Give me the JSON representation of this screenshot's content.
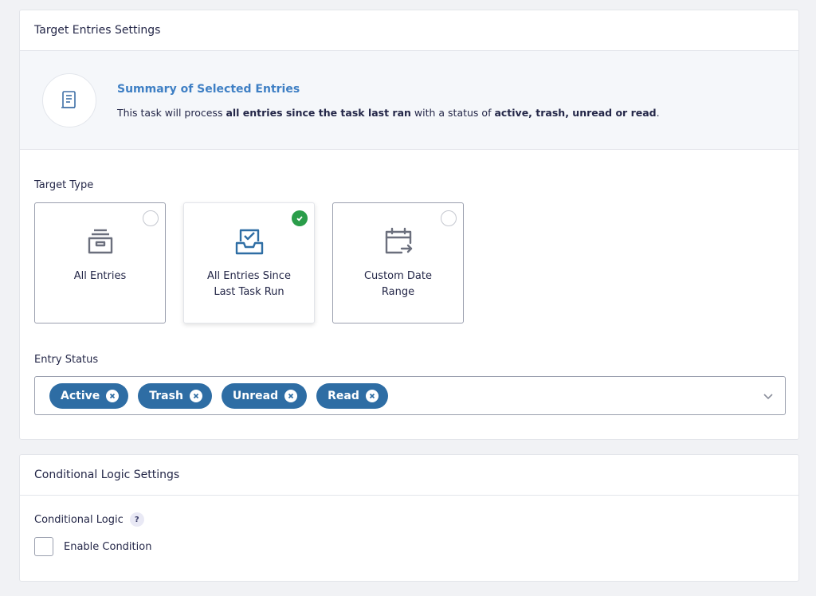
{
  "target_panel": {
    "title": "Target Entries Settings",
    "summary": {
      "title": "Summary of Selected Entries",
      "text_prefix": "This task will process ",
      "text_bold1": "all entries since the task last ran",
      "text_mid": " with a status of ",
      "text_bold2": "active, trash, unread or read",
      "text_suffix": "."
    },
    "target_type": {
      "label": "Target Type",
      "options": [
        {
          "label": "All Entries",
          "selected": false,
          "icon": "archive-box-icon"
        },
        {
          "label": "All Entries Since Last Task Run",
          "selected": true,
          "icon": "inbox-check-icon"
        },
        {
          "label": "Custom Date Range",
          "selected": false,
          "icon": "calendar-arrow-icon"
        }
      ]
    },
    "entry_status": {
      "label": "Entry Status",
      "selected": [
        "Active",
        "Trash",
        "Unread",
        "Read"
      ]
    }
  },
  "logic_panel": {
    "title": "Conditional Logic Settings",
    "field_label": "Conditional Logic",
    "help": "?",
    "checkbox_label": "Enable Condition",
    "checked": false
  },
  "colors": {
    "accent": "#3e7fc4",
    "pill": "#2e6da4",
    "success": "#2a9d4a"
  }
}
